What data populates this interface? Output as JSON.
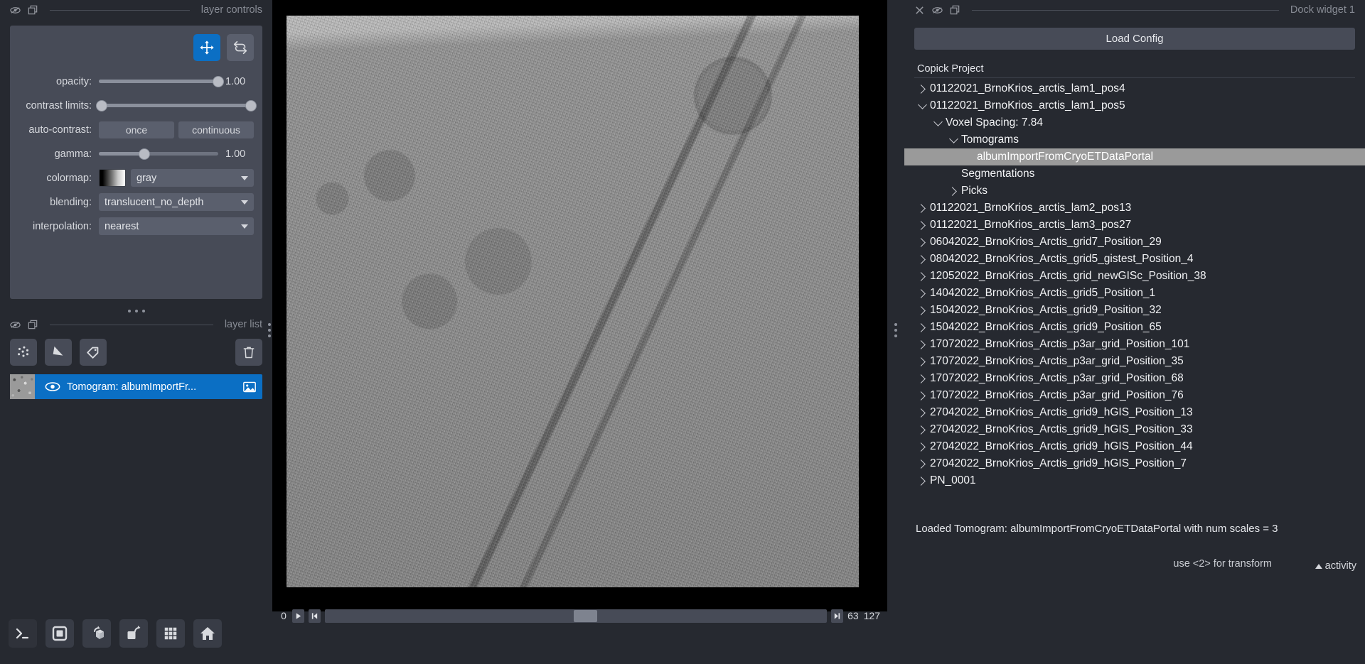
{
  "left_dock": {
    "title": "layer controls",
    "icons": [
      "hide-icon",
      "float-icon"
    ],
    "tools": [
      {
        "name": "pan-zoom-tool",
        "active": true
      },
      {
        "name": "transform-tool",
        "active": false
      }
    ],
    "controls": {
      "opacity": {
        "label": "opacity:",
        "value": "1.00",
        "knob_pct": 100,
        "fill_pct": 100
      },
      "contrast_limits": {
        "label": "contrast limits:",
        "low_pct": 2,
        "high_pct": 98
      },
      "auto_contrast": {
        "label": "auto-contrast:",
        "once": "once",
        "continuous": "continuous"
      },
      "gamma": {
        "label": "gamma:",
        "value": "1.00",
        "knob_pct": 38,
        "fill_pct": 38
      },
      "colormap": {
        "label": "colormap:",
        "value": "gray"
      },
      "blending": {
        "label": "blending:",
        "value": "translucent_no_depth"
      },
      "interpolation": {
        "label": "interpolation:",
        "value": "nearest"
      }
    }
  },
  "layer_list_dock": {
    "title": "layer list",
    "icons": [
      "hide-icon",
      "float-icon"
    ],
    "buttons": [
      {
        "name": "new-points-layer-button",
        "icon": "points-icon"
      },
      {
        "name": "new-shapes-layer-button",
        "icon": "shapes-icon"
      },
      {
        "name": "new-labels-layer-button",
        "icon": "labels-icon"
      },
      {
        "name": "delete-layer-button",
        "icon": "trash-icon"
      }
    ],
    "layers": [
      {
        "name": "Tomogram: albumImportFr...",
        "visible": true,
        "type_icon": "image-icon",
        "selected": true
      }
    ]
  },
  "viewer_buttons": [
    {
      "name": "console-button",
      "icon": "terminal-icon"
    },
    {
      "name": "ndisplay-2d-button",
      "icon": "square-icon"
    },
    {
      "name": "roll-dims-button",
      "icon": "cube-rotate-icon"
    },
    {
      "name": "transpose-dims-button",
      "icon": "square-rotate-icon"
    },
    {
      "name": "grid-view-button",
      "icon": "grid-icon"
    },
    {
      "name": "home-button",
      "icon": "home-icon"
    }
  ],
  "canvas": {
    "frame_slider": {
      "min_label": "0",
      "current_label": "63",
      "max_label": "127",
      "handle_pct": 49.5,
      "play_icon": "play-icon",
      "step_icon": "step-start-icon",
      "end_icon": "step-end-icon"
    }
  },
  "right_dock": {
    "title": "Dock widget 1",
    "icons": [
      "close-icon",
      "hide-icon",
      "float-icon"
    ],
    "load_config_label": "Load Config",
    "project_label": "Copick Project",
    "tree": [
      {
        "label": "01122021_BrnoKrios_arctis_lam1_pos4",
        "indent": 0,
        "state": "collapsed",
        "selected": false
      },
      {
        "label": "01122021_BrnoKrios_arctis_lam1_pos5",
        "indent": 0,
        "state": "expanded",
        "selected": false
      },
      {
        "label": "Voxel Spacing: 7.84",
        "indent": 1,
        "state": "expanded",
        "selected": false
      },
      {
        "label": "Tomograms",
        "indent": 2,
        "state": "expanded",
        "selected": false
      },
      {
        "label": "albumImportFromCryoETDataPortal",
        "indent": 3,
        "state": "leaf",
        "selected": true
      },
      {
        "label": "Segmentations",
        "indent": 2,
        "state": "leaf",
        "selected": false
      },
      {
        "label": "Picks",
        "indent": 2,
        "state": "collapsed",
        "selected": false
      },
      {
        "label": "01122021_BrnoKrios_arctis_lam2_pos13",
        "indent": 0,
        "state": "collapsed",
        "selected": false
      },
      {
        "label": "01122021_BrnoKrios_arctis_lam3_pos27",
        "indent": 0,
        "state": "collapsed",
        "selected": false
      },
      {
        "label": "06042022_BrnoKrios_Arctis_grid7_Position_29",
        "indent": 0,
        "state": "collapsed",
        "selected": false
      },
      {
        "label": "08042022_BrnoKrios_Arctis_grid5_gistest_Position_4",
        "indent": 0,
        "state": "collapsed",
        "selected": false
      },
      {
        "label": "12052022_BrnoKrios_Arctis_grid_newGISc_Position_38",
        "indent": 0,
        "state": "collapsed",
        "selected": false
      },
      {
        "label": "14042022_BrnoKrios_Arctis_grid5_Position_1",
        "indent": 0,
        "state": "collapsed",
        "selected": false
      },
      {
        "label": "15042022_BrnoKrios_Arctis_grid9_Position_32",
        "indent": 0,
        "state": "collapsed",
        "selected": false
      },
      {
        "label": "15042022_BrnoKrios_Arctis_grid9_Position_65",
        "indent": 0,
        "state": "collapsed",
        "selected": false
      },
      {
        "label": "17072022_BrnoKrios_Arctis_p3ar_grid_Position_101",
        "indent": 0,
        "state": "collapsed",
        "selected": false
      },
      {
        "label": "17072022_BrnoKrios_Arctis_p3ar_grid_Position_35",
        "indent": 0,
        "state": "collapsed",
        "selected": false
      },
      {
        "label": "17072022_BrnoKrios_Arctis_p3ar_grid_Position_68",
        "indent": 0,
        "state": "collapsed",
        "selected": false
      },
      {
        "label": "17072022_BrnoKrios_Arctis_p3ar_grid_Position_76",
        "indent": 0,
        "state": "collapsed",
        "selected": false
      },
      {
        "label": "27042022_BrnoKrios_Arctis_grid9_hGIS_Position_13",
        "indent": 0,
        "state": "collapsed",
        "selected": false
      },
      {
        "label": "27042022_BrnoKrios_Arctis_grid9_hGIS_Position_33",
        "indent": 0,
        "state": "collapsed",
        "selected": false
      },
      {
        "label": "27042022_BrnoKrios_Arctis_grid9_hGIS_Position_44",
        "indent": 0,
        "state": "collapsed",
        "selected": false
      },
      {
        "label": "27042022_BrnoKrios_Arctis_grid9_hGIS_Position_7",
        "indent": 0,
        "state": "collapsed",
        "selected": false
      },
      {
        "label": "PN_0001",
        "indent": 0,
        "state": "collapsed",
        "selected": false
      }
    ]
  },
  "statusbar": {
    "status": "Loaded Tomogram: albumImportFromCryoETDataPortal with num scales = 3",
    "hint": "use <2> for transform",
    "activity_label": "activity"
  },
  "colors": {
    "accent": "#0b6fc4",
    "panel": "#262930",
    "control_box": "#474b57",
    "widget": "#5a5f6d",
    "selection_gray": "#9a9a9a"
  }
}
